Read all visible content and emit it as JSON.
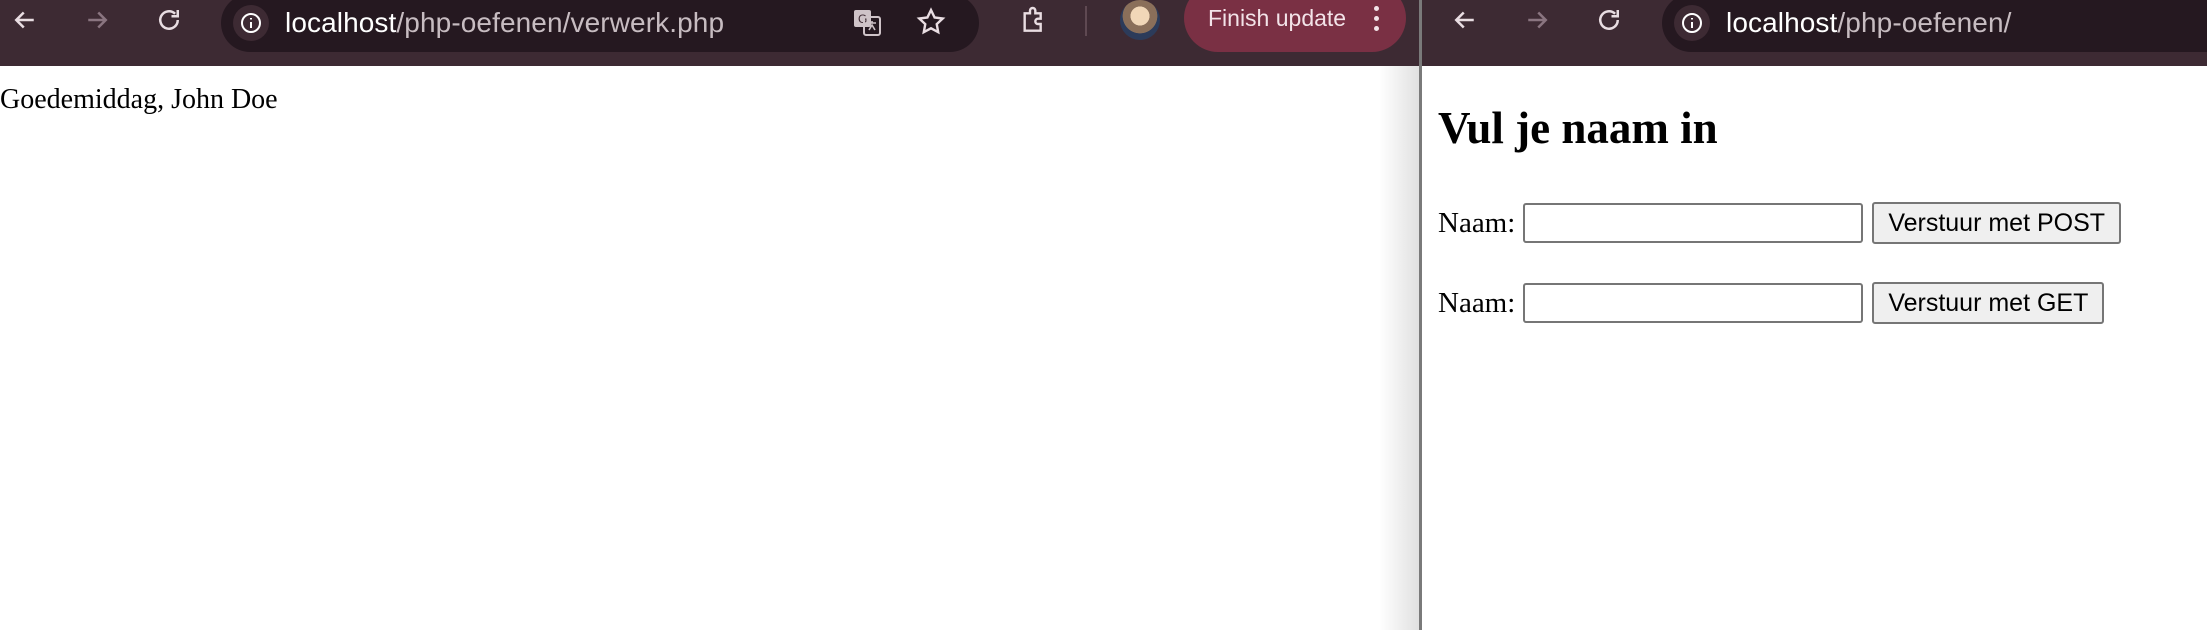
{
  "left_window": {
    "url_host": "localhost",
    "url_path": "/php-oefenen/verwerk.php",
    "finish_update_label": "Finish update",
    "page": {
      "greeting": "Goedemiddag, John Doe"
    }
  },
  "right_window": {
    "url_host": "localhost",
    "url_path": "/php-oefenen/",
    "page": {
      "heading": "Vul je naam in",
      "forms": [
        {
          "label": "Naam:",
          "value": "",
          "button": "Verstuur met POST"
        },
        {
          "label": "Naam:",
          "value": "",
          "button": "Verstuur met GET"
        }
      ]
    }
  },
  "icons": [
    "back-icon",
    "forward-icon",
    "reload-icon",
    "info-icon",
    "translate-icon",
    "star-icon",
    "extensions-icon",
    "profile-avatar",
    "more-vert-icon"
  ],
  "colors": {
    "toolbar": "#3d2a33",
    "omnibox": "#251820",
    "finish_update": "#7a3044"
  }
}
